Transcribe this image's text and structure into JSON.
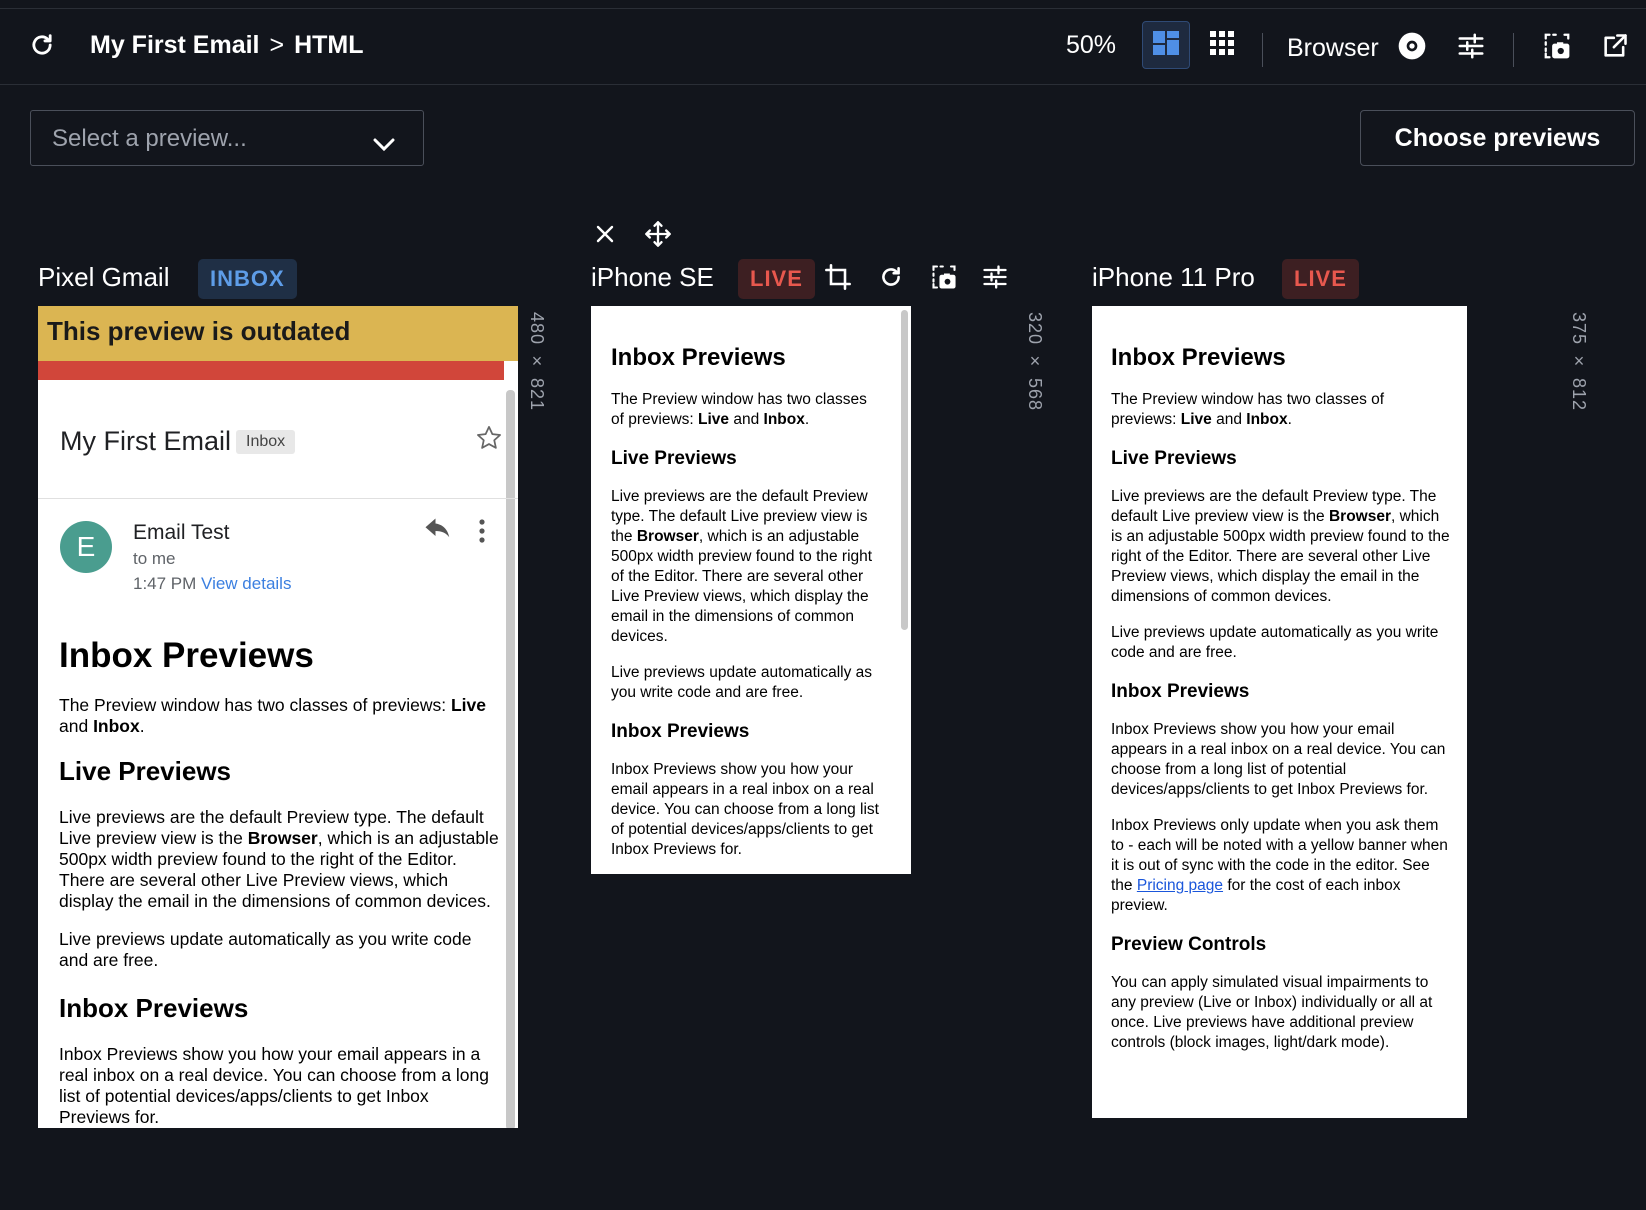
{
  "header": {
    "crumb_project": "My First Email",
    "crumb_sep": ">",
    "crumb_page": "HTML",
    "zoom": "50%",
    "browser_label": "Browser"
  },
  "controls": {
    "select_placeholder": "Select a preview...",
    "choose_label": "Choose previews"
  },
  "previews": [
    {
      "name": "Pixel Gmail",
      "badge": "INBOX",
      "dims": "480 × 821",
      "outdated": "This preview is outdated",
      "gmail": {
        "subject": "My First Email",
        "label": "Inbox",
        "avatar_letter": "E",
        "sender": "Email Test",
        "to": "to me",
        "time": "1:47 PM",
        "view_details": "View details"
      }
    },
    {
      "name": "iPhone SE",
      "badge": "LIVE",
      "dims": "320 × 568"
    },
    {
      "name": "iPhone 11 Pro",
      "badge": "LIVE",
      "dims": "375 × 812"
    }
  ],
  "email": {
    "h1": "Inbox Previews",
    "intro_a": "The Preview window has two classes of previews: ",
    "intro_live": "Live",
    "intro_and": " and ",
    "intro_inbox": "Inbox",
    "intro_end": ".",
    "live_h": "Live Previews",
    "live_p1_a": "Live previews are the default Preview type. The default Live preview view is the ",
    "live_p1_b": "Browser",
    "live_p1_c": ", which is an adjustable 500px width preview found to the right of the Editor. There are several other Live Preview views, which display the email in the dimensions of common devices.",
    "live_p2": "Live previews update automatically as you write code and are free.",
    "inbox_h": "Inbox Previews",
    "inbox_p1": "Inbox Previews show you how your email appears in a real inbox on a real device. You can choose from a long list of potential devices/apps/clients to get Inbox Previews for.",
    "inbox_p2_a": "Inbox Previews only update when you ask them to - each will be noted with a yellow banner when it is out of sync with the code in the editor. See the ",
    "inbox_p2_link": "Pricing page",
    "inbox_p2_b": " for the cost of each inbox preview.",
    "controls_h": "Preview Controls",
    "controls_p": "You can apply simulated visual impairments to any preview (Live or Inbox) individually or all at once. Live previews have additional preview controls (block images, light/dark mode)."
  },
  "colors": {
    "background": "#12151c",
    "inbox_badge": "#5e9de8",
    "live_badge": "#e8584e",
    "outdated_banner": "#dbb552",
    "gmail_red": "#d1463a",
    "avatar": "#4a9d8f"
  },
  "icons": [
    "refresh-icon",
    "layout-icon",
    "grid-icon",
    "eye-icon",
    "sliders-icon",
    "screenshot-icon",
    "external-link-icon",
    "chevron-down-icon",
    "close-icon",
    "move-icon",
    "crop-icon",
    "reload-icon",
    "star-icon",
    "reply-icon",
    "more-vert-icon"
  ]
}
